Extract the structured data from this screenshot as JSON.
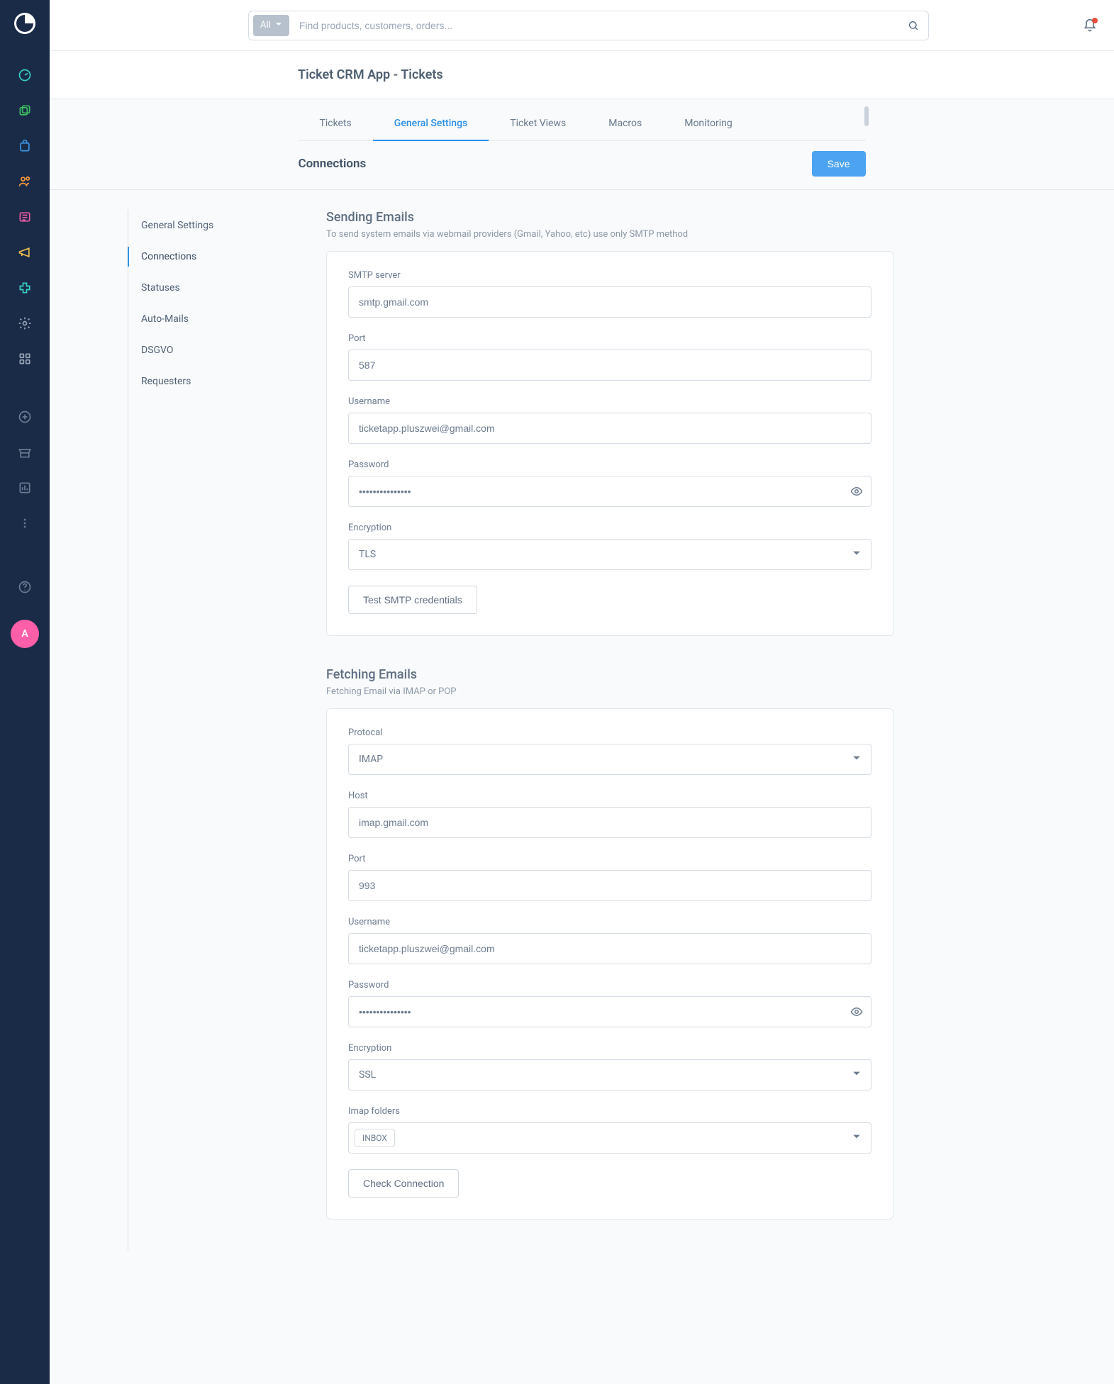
{
  "header": {
    "search_scope": "All",
    "search_placeholder": "Find products, customers, orders..."
  },
  "avatar_initial": "A",
  "page_title": "Ticket CRM App - Tickets",
  "tabs": [
    {
      "label": "Tickets"
    },
    {
      "label": "General Settings",
      "active": true
    },
    {
      "label": "Ticket Views"
    },
    {
      "label": "Macros"
    },
    {
      "label": "Monitoring"
    }
  ],
  "sub": {
    "title": "Connections",
    "save": "Save"
  },
  "sidenav": [
    {
      "label": "General Settings"
    },
    {
      "label": "Connections",
      "active": true
    },
    {
      "label": "Statuses"
    },
    {
      "label": "Auto-Mails"
    },
    {
      "label": "DSGVO"
    },
    {
      "label": "Requesters"
    }
  ],
  "sending": {
    "heading": "Sending Emails",
    "desc": "To send system emails via webmail providers (Gmail, Yahoo, etc) use only SMTP method",
    "smtp_label": "SMTP server",
    "smtp_value": "smtp.gmail.com",
    "port_label": "Port",
    "port_value": "587",
    "user_label": "Username",
    "user_value": "ticketapp.pluszwei@gmail.com",
    "pass_label": "Password",
    "pass_value": "•••••••••••••••",
    "enc_label": "Encryption",
    "enc_value": "TLS",
    "test_btn": "Test SMTP credentials"
  },
  "fetching": {
    "heading": "Fetching Emails",
    "desc": "Fetching Email via IMAP or POP",
    "proto_label": "Protocal",
    "proto_value": "IMAP",
    "host_label": "Host",
    "host_value": "imap.gmail.com",
    "port_label": "Port",
    "port_value": "993",
    "user_label": "Username",
    "user_value": "ticketapp.pluszwei@gmail.com",
    "pass_label": "Password",
    "pass_value": "•••••••••••••••",
    "enc_label": "Encryption",
    "enc_value": "SSL",
    "folders_label": "Imap folders",
    "folders_value": "INBOX",
    "check_btn": "Check Connection"
  }
}
